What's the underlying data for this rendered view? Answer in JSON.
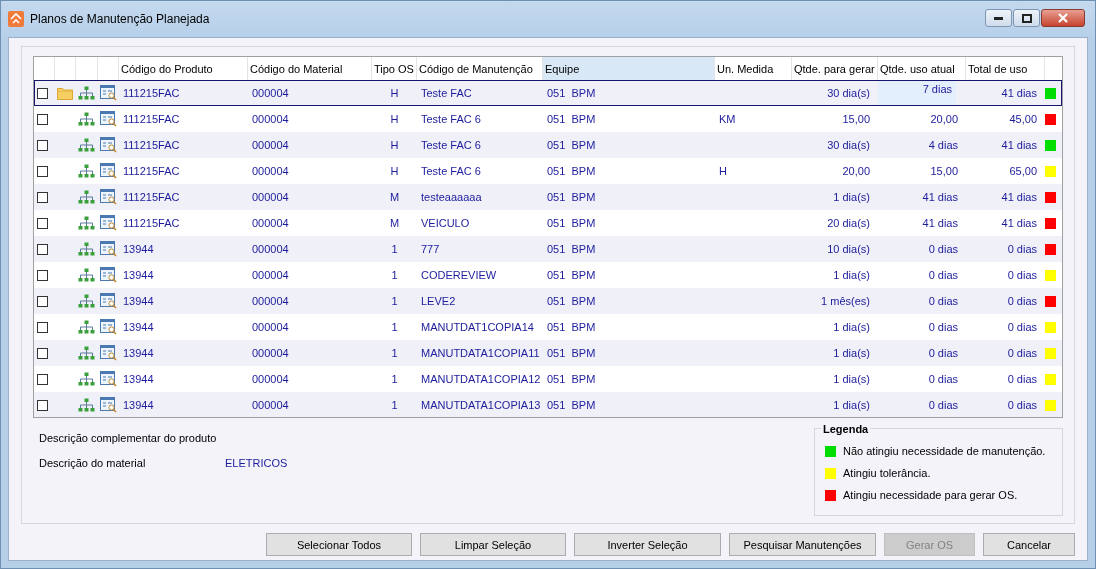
{
  "window": {
    "title": "Planos de Manutenção Planejada"
  },
  "table": {
    "columns": [
      {
        "label": "Código do Produto",
        "highlighted": false
      },
      {
        "label": "Código do Material",
        "highlighted": false
      },
      {
        "label": "Tipo OS",
        "highlighted": false
      },
      {
        "label": "Código de Manutenção",
        "highlighted": false
      },
      {
        "label": "Equipe",
        "highlighted": true
      },
      {
        "label": "Un. Medida",
        "highlighted": false
      },
      {
        "label": "Qtde. para gerar",
        "highlighted": false
      },
      {
        "label": "Qtde. uso atual",
        "highlighted": false
      },
      {
        "label": "Total de uso",
        "highlighted": false
      }
    ],
    "rows": [
      {
        "checked": false,
        "selected": true,
        "folder": true,
        "editing": true,
        "produto": "111215FAC",
        "material": "000004",
        "tipo": "H",
        "manutencao": "Teste FAC",
        "equipe": "051  BPM",
        "unidade": "",
        "gerar": "30 dia(s)",
        "atual": "7 dias",
        "total": "41 dias",
        "color": "#00dd00"
      },
      {
        "checked": false,
        "selected": false,
        "folder": false,
        "editing": false,
        "produto": "111215FAC",
        "material": "000004",
        "tipo": "H",
        "manutencao": "Teste FAC 6",
        "equipe": "051  BPM",
        "unidade": "KM",
        "gerar": "15,00",
        "atual": "20,00",
        "total": "45,00",
        "color": "#ff0000"
      },
      {
        "checked": false,
        "selected": false,
        "folder": false,
        "editing": false,
        "produto": "111215FAC",
        "material": "000004",
        "tipo": "H",
        "manutencao": "Teste FAC 6",
        "equipe": "051  BPM",
        "unidade": "",
        "gerar": "30 dia(s)",
        "atual": "4 dias",
        "total": "41 dias",
        "color": "#00dd00"
      },
      {
        "checked": false,
        "selected": false,
        "folder": false,
        "editing": false,
        "produto": "111215FAC",
        "material": "000004",
        "tipo": "H",
        "manutencao": "Teste FAC 6",
        "equipe": "051  BPM",
        "unidade": "H",
        "gerar": "20,00",
        "atual": "15,00",
        "total": "65,00",
        "color": "#ffff00"
      },
      {
        "checked": false,
        "selected": false,
        "folder": false,
        "editing": false,
        "produto": "111215FAC",
        "material": "000004",
        "tipo": "M",
        "manutencao": "testeaaaaaa",
        "equipe": "051  BPM",
        "unidade": "",
        "gerar": "1 dia(s)",
        "atual": "41 dias",
        "total": "41 dias",
        "color": "#ff0000"
      },
      {
        "checked": false,
        "selected": false,
        "folder": false,
        "editing": false,
        "produto": "111215FAC",
        "material": "000004",
        "tipo": "M",
        "manutencao": "VEICULO",
        "equipe": "051  BPM",
        "unidade": "",
        "gerar": "20 dia(s)",
        "atual": "41 dias",
        "total": "41 dias",
        "color": "#ff0000"
      },
      {
        "checked": false,
        "selected": false,
        "folder": false,
        "editing": false,
        "produto": "13944",
        "material": "000004",
        "tipo": "1",
        "manutencao": "777",
        "equipe": "051  BPM",
        "unidade": "",
        "gerar": "10 dia(s)",
        "atual": "0 dias",
        "total": "0 dias",
        "color": "#ff0000"
      },
      {
        "checked": false,
        "selected": false,
        "folder": false,
        "editing": false,
        "produto": "13944",
        "material": "000004",
        "tipo": "1",
        "manutencao": "CODEREVIEW",
        "equipe": "051  BPM",
        "unidade": "",
        "gerar": "1 dia(s)",
        "atual": "0 dias",
        "total": "0 dias",
        "color": "#ffff00"
      },
      {
        "checked": false,
        "selected": false,
        "folder": false,
        "editing": false,
        "produto": "13944",
        "material": "000004",
        "tipo": "1",
        "manutencao": "LEVE2",
        "equipe": "051  BPM",
        "unidade": "",
        "gerar": "1 mês(es)",
        "atual": "0 dias",
        "total": "0 dias",
        "color": "#ff0000"
      },
      {
        "checked": false,
        "selected": false,
        "folder": false,
        "editing": false,
        "produto": "13944",
        "material": "000004",
        "tipo": "1",
        "manutencao": "MANUTDAT1COPIA14",
        "equipe": "051  BPM",
        "unidade": "",
        "gerar": "1 dia(s)",
        "atual": "0 dias",
        "total": "0 dias",
        "color": "#ffff00"
      },
      {
        "checked": false,
        "selected": false,
        "folder": false,
        "editing": false,
        "produto": "13944",
        "material": "000004",
        "tipo": "1",
        "manutencao": "MANUTDATA1COPIA11",
        "equipe": "051  BPM",
        "unidade": "",
        "gerar": "1 dia(s)",
        "atual": "0 dias",
        "total": "0 dias",
        "color": "#ffff00"
      },
      {
        "checked": false,
        "selected": false,
        "folder": false,
        "editing": false,
        "produto": "13944",
        "material": "000004",
        "tipo": "1",
        "manutencao": "MANUTDATA1COPIA12",
        "equipe": "051  BPM",
        "unidade": "",
        "gerar": "1 dia(s)",
        "atual": "0 dias",
        "total": "0 dias",
        "color": "#ffff00"
      },
      {
        "checked": false,
        "selected": false,
        "folder": false,
        "editing": false,
        "produto": "13944",
        "material": "000004",
        "tipo": "1",
        "manutencao": "MANUTDATA1COPIA13",
        "equipe": "051  BPM",
        "unidade": "",
        "gerar": "1 dia(s)",
        "atual": "0 dias",
        "total": "0 dias",
        "color": "#ffff00"
      }
    ]
  },
  "details": [
    {
      "label": "Descrição complementar do produto"
    },
    {
      "label": "Descrição do material",
      "value": "ELETRICOS"
    }
  ],
  "legend": {
    "title": "Legenda",
    "items": [
      {
        "label": "Não atingiu necessidade de manutenção.",
        "color": "#00dd00"
      },
      {
        "label": "Atingiu tolerância.",
        "color": "#ffff00"
      },
      {
        "label": "Atingiu necessidade para gerar OS.",
        "color": "#ff0000"
      }
    ]
  },
  "buttons": [
    {
      "label": "Selecionar Todos",
      "disabled": false
    },
    {
      "label": "Limpar Seleção",
      "disabled": false
    },
    {
      "label": "Inverter Seleção",
      "disabled": false
    },
    {
      "label": "Pesquisar Manutenções",
      "disabled": false
    },
    {
      "label": "Gerar OS",
      "disabled": true
    },
    {
      "label": "Cancelar",
      "disabled": false
    }
  ]
}
